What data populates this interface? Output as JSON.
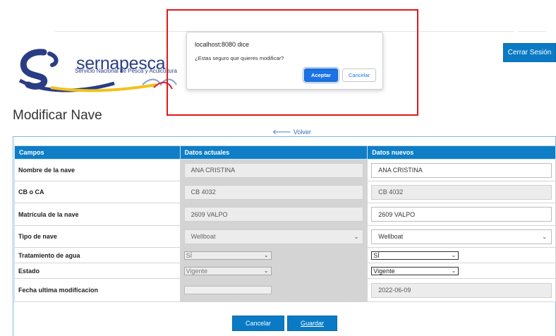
{
  "header": {
    "logo_text": "sernapesca",
    "logo_sub": "Servicio Nacional de Pesca y Acuicultura",
    "logout_label": "Cerrar Sesión"
  },
  "page": {
    "title": "Modificar Nave",
    "back_label": "Volver"
  },
  "table": {
    "headers": [
      "Campos",
      "Datos actuales",
      "Datos nuevos"
    ],
    "rows": [
      {
        "label": "Nombre de la nave",
        "actual": "ANA CRISTINA",
        "nuevo": "ANA CRISTINA"
      },
      {
        "label": "CB o CA",
        "actual": "CB 4032",
        "nuevo": "CB 4032"
      },
      {
        "label": "Matrícula de la nave",
        "actual": "2609 VALPO",
        "nuevo": "2609 VALPO"
      },
      {
        "label": "Tipo de nave",
        "actual": "Wellboat",
        "nuevo": "Wellboat"
      },
      {
        "label": "Tratamiento de agua",
        "actual": "SÍ",
        "nuevo": "SÍ"
      },
      {
        "label": "Estado",
        "actual": "Vigente",
        "nuevo": "Vigente"
      },
      {
        "label": "Fecha ultima modificacion",
        "actual": "",
        "nuevo": "2022-06-09"
      }
    ]
  },
  "actions": {
    "cancel_label": "Cancelar",
    "save_label": "Guardar"
  },
  "dialog": {
    "title": "localhost:8080 dice",
    "message": "¿Estas seguro que quieres modificar?",
    "ok_label": "Aceptar",
    "cancel_label": "Cancelar"
  },
  "colors": {
    "primary": "#0a7ac4",
    "header_bg": "#0f7ec7",
    "annotation": "#e0181b",
    "dialog_accent": "#1a73e8"
  }
}
